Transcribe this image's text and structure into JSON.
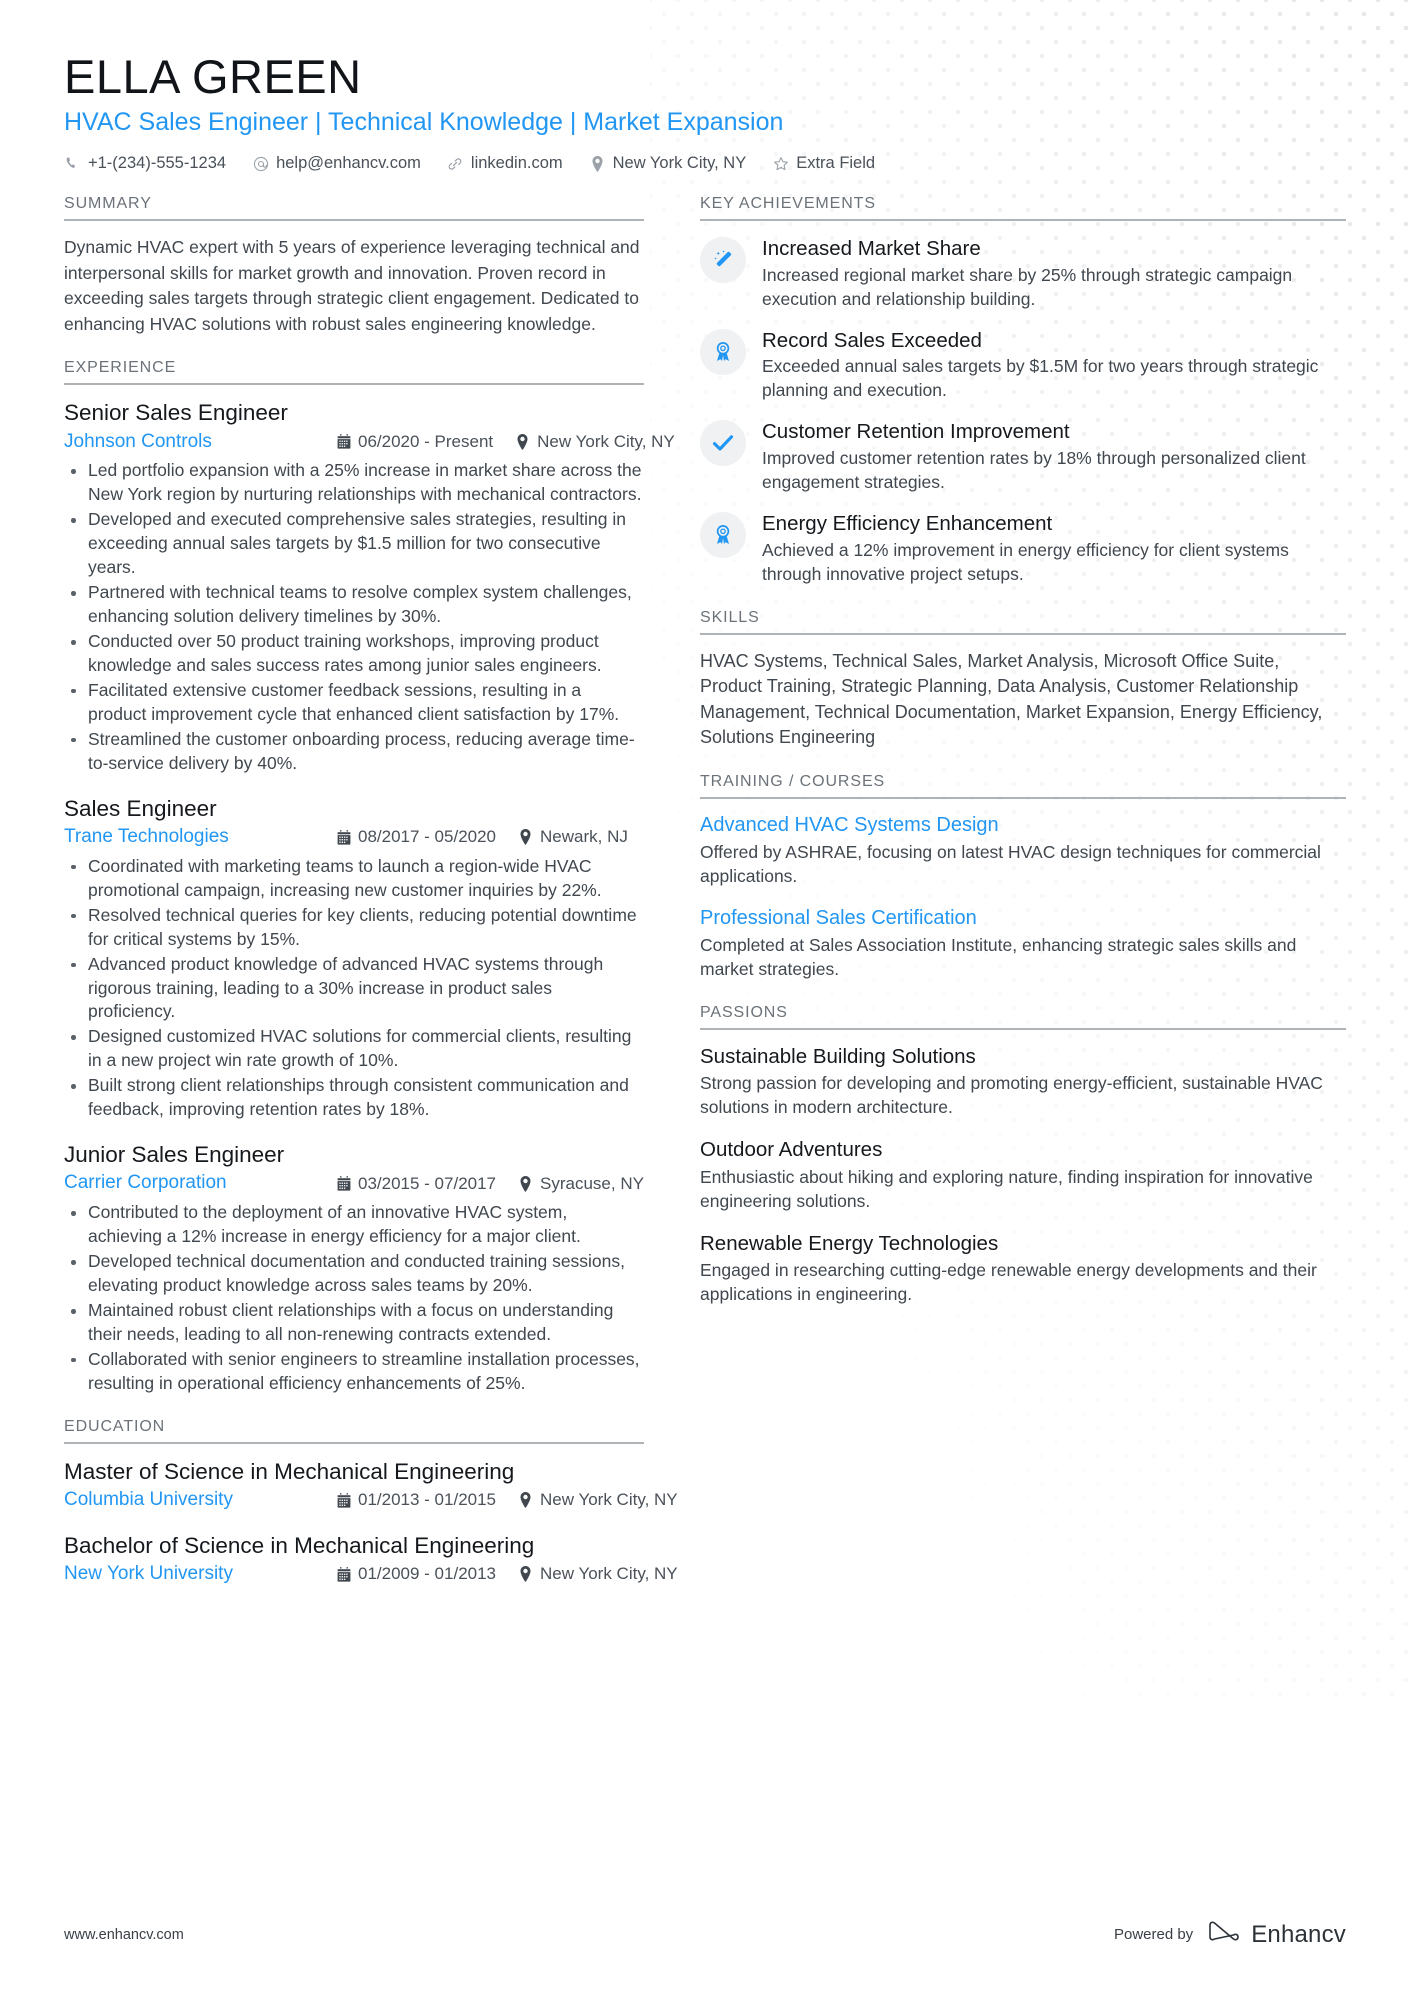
{
  "colors": {
    "accent": "#2196f3",
    "heading": "#15191d",
    "body": "#40474e",
    "muted": "#6b7279",
    "rule": "#aeb3b8"
  },
  "header": {
    "full_name": "ELLA GREEN",
    "job_title": "HVAC Sales Engineer | Technical Knowledge | Market Expansion",
    "contacts": [
      {
        "icon": "phone-icon",
        "text": "+1-(234)-555-1234"
      },
      {
        "icon": "email-icon",
        "text": "help@enhancv.com"
      },
      {
        "icon": "link-icon",
        "text": "linkedin.com"
      },
      {
        "icon": "location-pin-icon",
        "text": "New York City, NY"
      },
      {
        "icon": "star-icon",
        "text": "Extra Field"
      }
    ]
  },
  "left": {
    "summary": {
      "heading": "SUMMARY",
      "text": "Dynamic HVAC expert with 5 years of experience leveraging technical and interpersonal skills for market growth and innovation. Proven record in exceeding sales targets through strategic client engagement. Dedicated to enhancing HVAC solutions with robust sales engineering knowledge."
    },
    "experience": {
      "heading": "EXPERIENCE",
      "entries": [
        {
          "title": "Senior Sales Engineer",
          "org": "Johnson Controls",
          "dates": "06/2020 - Present",
          "location": "New York City, NY",
          "bullets": [
            "Led portfolio expansion with a 25% increase in market share across the New York region by nurturing relationships with mechanical contractors.",
            "Developed and executed comprehensive sales strategies, resulting in exceeding annual sales targets by $1.5 million for two consecutive years.",
            "Partnered with technical teams to resolve complex system challenges, enhancing solution delivery timelines by 30%.",
            "Conducted over 50 product training workshops, improving product knowledge and sales success rates among junior sales engineers.",
            "Facilitated extensive customer feedback sessions, resulting in a product improvement cycle that enhanced client satisfaction by 17%.",
            "Streamlined the customer onboarding process, reducing average time-to-service delivery by 40%."
          ]
        },
        {
          "title": "Sales Engineer",
          "org": "Trane Technologies",
          "dates": "08/2017 - 05/2020",
          "location": "Newark, NJ",
          "bullets": [
            "Coordinated with marketing teams to launch a region-wide HVAC promotional campaign, increasing new customer inquiries by 22%.",
            "Resolved technical queries for key clients, reducing potential downtime for critical systems by 15%.",
            "Advanced product knowledge of advanced HVAC systems through rigorous training, leading to a 30% increase in product sales proficiency.",
            "Designed customized HVAC solutions for commercial clients, resulting in a new project win rate growth of 10%.",
            "Built strong client relationships through consistent communication and feedback, improving retention rates by 18%."
          ]
        },
        {
          "title": "Junior Sales Engineer",
          "org": "Carrier Corporation",
          "dates": "03/2015 - 07/2017",
          "location": "Syracuse, NY",
          "bullets": [
            "Contributed to the deployment of an innovative HVAC system, achieving a 12% increase in energy efficiency for a major client.",
            "Developed technical documentation and conducted training sessions, elevating product knowledge across sales teams by 20%.",
            "Maintained robust client relationships with a focus on understanding their needs, leading to all non-renewing contracts extended.",
            "Collaborated with senior engineers to streamline installation processes, resulting in operational efficiency enhancements of 25%."
          ]
        }
      ]
    },
    "education": {
      "heading": "EDUCATION",
      "entries": [
        {
          "title": "Master of Science in Mechanical Engineering",
          "org": "Columbia University",
          "dates": "01/2013 - 01/2015",
          "location": "New York City, NY"
        },
        {
          "title": "Bachelor of Science in Mechanical Engineering",
          "org": "New York University",
          "dates": "01/2009 - 01/2013",
          "location": "New York City, NY"
        }
      ]
    }
  },
  "right": {
    "achievements": {
      "heading": "KEY ACHIEVEMENTS",
      "items": [
        {
          "icon": "magic-wand-icon",
          "title": "Increased Market Share",
          "desc": "Increased regional market share by 25% through strategic campaign execution and relationship building."
        },
        {
          "icon": "award-ribbon-icon",
          "title": "Record Sales Exceeded",
          "desc": "Exceeded annual sales targets by $1.5M for two years through strategic planning and execution."
        },
        {
          "icon": "checkmark-icon",
          "title": "Customer Retention Improvement",
          "desc": "Improved customer retention rates by 18% through personalized client engagement strategies."
        },
        {
          "icon": "award-ribbon-icon",
          "title": "Energy Efficiency Enhancement",
          "desc": "Achieved a 12% improvement in energy efficiency for client systems through innovative project setups."
        }
      ]
    },
    "skills": {
      "heading": "SKILLS",
      "text": "HVAC Systems, Technical Sales, Market Analysis, Microsoft Office Suite, Product Training, Strategic Planning, Data Analysis, Customer Relationship Management, Technical Documentation, Market Expansion, Energy Efficiency, Solutions Engineering"
    },
    "training": {
      "heading": "TRAINING / COURSES",
      "entries": [
        {
          "title": "Advanced HVAC Systems Design",
          "desc": "Offered by ASHRAE, focusing on latest HVAC design techniques for commercial applications."
        },
        {
          "title": "Professional Sales Certification",
          "desc": "Completed at Sales Association Institute, enhancing strategic sales skills and market strategies."
        }
      ]
    },
    "passions": {
      "heading": "PASSIONS",
      "entries": [
        {
          "title": "Sustainable Building Solutions",
          "desc": "Strong passion for developing and promoting energy-efficient, sustainable HVAC solutions in modern architecture."
        },
        {
          "title": "Outdoor Adventures",
          "desc": "Enthusiastic about hiking and exploring nature, finding inspiration for innovative engineering solutions."
        },
        {
          "title": "Renewable Energy Technologies",
          "desc": "Engaged in researching cutting-edge renewable energy developments and their applications in engineering."
        }
      ]
    }
  },
  "footer": {
    "url": "www.enhancv.com",
    "powered_by": "Powered by",
    "brand_name": "Enhancv"
  }
}
